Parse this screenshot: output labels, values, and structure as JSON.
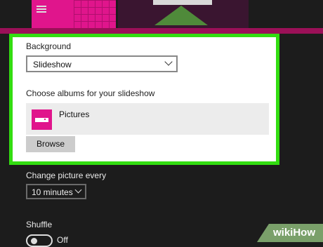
{
  "background_section": {
    "label": "Background",
    "selected": "Slideshow"
  },
  "albums_section": {
    "label": "Choose albums for your slideshow",
    "albums": [
      {
        "name": "Pictures"
      }
    ],
    "browse_label": "Browse"
  },
  "interval_section": {
    "label": "Change picture every",
    "selected": "10 minutes"
  },
  "shuffle_section": {
    "label": "Shuffle",
    "state_label": "Off",
    "enabled": false
  },
  "watermark": {
    "text": "wikiHow"
  },
  "colors": {
    "highlight": "#33dd11",
    "accent_pink": "#e0158c",
    "panel_dark": "#1c1c1c"
  }
}
